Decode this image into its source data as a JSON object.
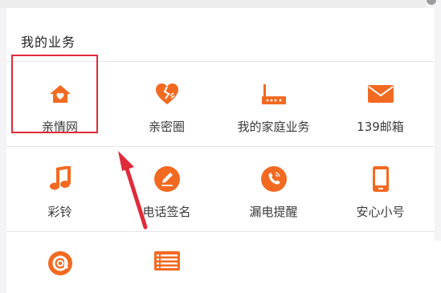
{
  "section": {
    "title": "我的业务"
  },
  "services": [
    {
      "label": "亲情网",
      "icon": "house-heart-icon"
    },
    {
      "label": "亲密圈",
      "icon": "broken-heart-icon"
    },
    {
      "label": "我的家庭业务",
      "icon": "router-icon"
    },
    {
      "label": "139邮箱",
      "icon": "envelope-icon"
    },
    {
      "label": "彩铃",
      "icon": "music-note-icon"
    },
    {
      "label": "电话签名",
      "icon": "pen-signature-icon"
    },
    {
      "label": "漏电提醒",
      "icon": "phone-ring-icon"
    },
    {
      "label": "安心小号",
      "icon": "mobile-phone-icon"
    },
    {
      "label": "",
      "icon": "at-sign-icon"
    },
    {
      "label": "",
      "icon": "list-icon"
    }
  ],
  "colors": {
    "accent": "#f26a21",
    "highlight_box": "#e02b3a",
    "arrow": "#e02b3a",
    "text": "#3b3b3b"
  }
}
